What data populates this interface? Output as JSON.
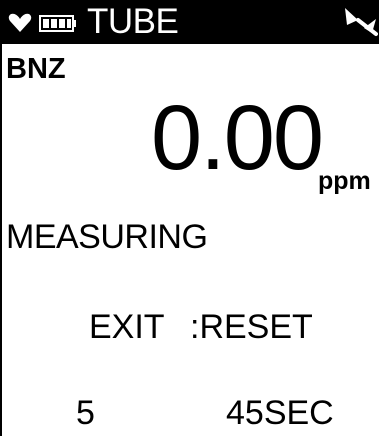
{
  "status_bar": {
    "mode": "TUBE",
    "icons": [
      "heart-icon",
      "battery-icon",
      "pump-icon"
    ]
  },
  "measurement": {
    "gas": "BNZ",
    "value": "0.00",
    "unit": "ppm",
    "status": "MEASURING"
  },
  "controls": {
    "exit_label": "EXIT",
    "reset_label": ":RESET"
  },
  "counters": {
    "strokes": "5",
    "time": "45SEC"
  },
  "colors": {
    "background": "#ffffff",
    "text": "#000000",
    "status_bar": "#000000",
    "status_bar_text": "#ffffff"
  }
}
